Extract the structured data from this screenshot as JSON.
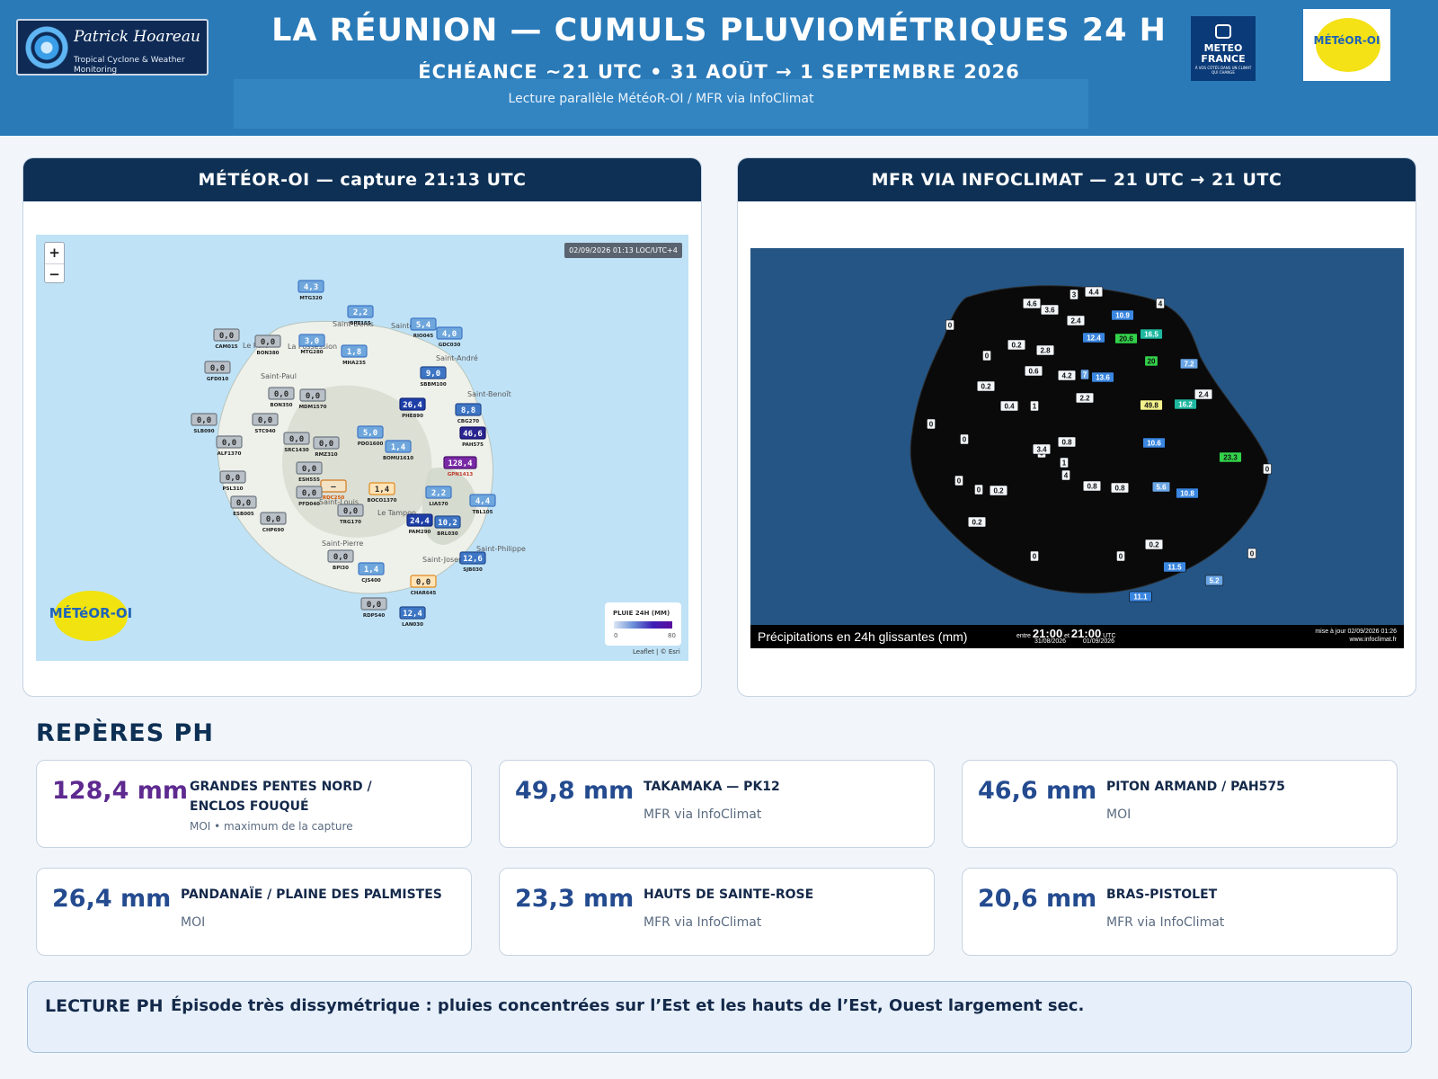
{
  "header": {
    "brand_name": "Patrick Hoareau",
    "brand_tagline": "Tropical Cyclone & Weather Monitoring",
    "title": "LA RÉUNION — CUMULS PLUVIOMÉTRIQUES 24 H",
    "subtitle": "ÉCHÉANCE ~21 UTC • 31 AOÛT → 1 SEPTEMBRE 2026",
    "sources_line": "Lecture parallèle MétéoR-OI / MFR via InfoClimat",
    "mf_logo_text": "METEO FRANCE",
    "mf_logo_tagline": "À VOS CÔTÉS DANS UN CLIMAT QUI CHANGE",
    "moi_logo_text": "MÉTéOR-OI"
  },
  "colors": {
    "header_bg": "#2a7ab8",
    "panel_head": "#0d3054",
    "accent": "#244b8f",
    "max_accent": "#5e2a90"
  },
  "panel_moi": {
    "title": "MÉTÉOR-OI — capture 21:13 UTC",
    "zoom_in": "+",
    "zoom_out": "−",
    "timestamp": "02/09/2026 01:13 LOC/UTC+4",
    "legend_title": "PLUIE 24H (MM)",
    "legend_min": "0",
    "legend_max": "80",
    "attribution": "Leaflet | © Esri",
    "logo_text": "MÉTéOR-OI",
    "places": [
      "Saint-Denis",
      "Sainte-Marie",
      "Saint-André",
      "Saint-Benoît",
      "Le Port",
      "La Possession",
      "Saint-Paul",
      "Saint-Louis",
      "Le Tampon",
      "Saint-Pierre",
      "Saint-Joseph",
      "Saint-Philippe"
    ],
    "stations": [
      {
        "code": "MTG320",
        "value": "4,3",
        "level": 1
      },
      {
        "code": "BRT155",
        "value": "2,2",
        "level": 1
      },
      {
        "code": "MTG280",
        "value": "3,0",
        "level": 1
      },
      {
        "code": "MHA235",
        "value": "1,8",
        "level": 1
      },
      {
        "code": "RIO045",
        "value": "5,4",
        "level": 1
      },
      {
        "code": "GDC030",
        "value": "4,0",
        "level": 1
      },
      {
        "code": "CAM015",
        "value": "0,0",
        "level": 0
      },
      {
        "code": "BON380",
        "value": "0,0",
        "level": 0
      },
      {
        "code": "GFD010",
        "value": "0,0",
        "level": 0
      },
      {
        "code": "BON350",
        "value": "0,0",
        "level": 0
      },
      {
        "code": "SBBM100",
        "value": "9,0",
        "level": 2
      },
      {
        "code": "MDM1570",
        "value": "0,0",
        "level": 0
      },
      {
        "code": "PHE890",
        "value": "26,4",
        "level": 3
      },
      {
        "code": "CBG270",
        "value": "8,8",
        "level": 2
      },
      {
        "code": "SLB090",
        "value": "0,0",
        "level": 0
      },
      {
        "code": "STC940",
        "value": "0,0",
        "level": 0
      },
      {
        "code": "PDO1600",
        "value": "5,0",
        "level": 1
      },
      {
        "code": "PAH575",
        "value": "46,6",
        "level": 4
      },
      {
        "code": "ALF1370",
        "value": "0,0",
        "level": 0
      },
      {
        "code": "SRC1430",
        "value": "0,0",
        "level": 0
      },
      {
        "code": "RMZ310",
        "value": "0,0",
        "level": 0
      },
      {
        "code": "BOMU1610",
        "value": "1,4",
        "level": 1
      },
      {
        "code": "GPN1413",
        "value": "128,4",
        "level": 5
      },
      {
        "code": "ESH555",
        "value": "0,0",
        "level": 0
      },
      {
        "code": "RDC250",
        "value": "—",
        "level": 6
      },
      {
        "code": "BOCO1370",
        "value": "1,4",
        "level": 7
      },
      {
        "code": "PSL310",
        "value": "0,0",
        "level": 0
      },
      {
        "code": "PFD040",
        "value": "0,0",
        "level": 0
      },
      {
        "code": "LIA570",
        "value": "2,2",
        "level": 1
      },
      {
        "code": "TBL105",
        "value": "4,4",
        "level": 1
      },
      {
        "code": "ESB005",
        "value": "0,0",
        "level": 0
      },
      {
        "code": "CHP690",
        "value": "0,0",
        "level": 0
      },
      {
        "code": "TRG170",
        "value": "0,0",
        "level": 0
      },
      {
        "code": "PAM290",
        "value": "24,4",
        "level": 3
      },
      {
        "code": "BRL030",
        "value": "10,2",
        "level": 2
      },
      {
        "code": "BPI30",
        "value": "0,0",
        "level": 0
      },
      {
        "code": "CJS400",
        "value": "1,4",
        "level": 1
      },
      {
        "code": "SJB030",
        "value": "12,6",
        "level": 2
      },
      {
        "code": "CHAR645",
        "value": "0,0",
        "level": 7
      },
      {
        "code": "RDP540",
        "value": "0,0",
        "level": 0
      },
      {
        "code": "LAN030",
        "value": "12,4",
        "level": 2
      }
    ]
  },
  "panel_mfr": {
    "title": "MFR VIA INFOCLIMAT — 21 UTC → 21 UTC",
    "caption": "Précipitations en 24h glissantes (mm)",
    "between": "entre",
    "and": "et",
    "start_time": "21:00",
    "end_time": "21:00",
    "tz": "UTC",
    "start_date": "31/08/2026",
    "end_date": "01/09/2026",
    "update": "mise à jour 02/09/2026 01:26",
    "site": "www.infoclimat.fr",
    "values": [
      "4.6",
      "3.6",
      "3",
      "4.4",
      "4",
      "0",
      "2.4",
      "10.9",
      "16.5",
      "12.4",
      "20.6",
      "0.2",
      "2.8",
      "0",
      "20",
      "7.2",
      "0.6",
      "4.2",
      "7",
      "13.6",
      "0.2",
      "2.2",
      "49.8",
      "16.2",
      "2.4",
      "0.4",
      "1",
      "0",
      "0",
      "0.8",
      "0",
      "10.6",
      "1",
      "23.3",
      "0",
      "3.4",
      "4",
      "0",
      "0.2",
      "0",
      "0.8",
      "0.8",
      "5.6",
      "10.8",
      "0.2",
      "0.2",
      "0",
      "0",
      "0",
      "11.5",
      "5.2",
      "11.1"
    ]
  },
  "reperes": {
    "title": "REPÈRES PH",
    "cards": [
      {
        "value": "128,4 mm",
        "name_l1": "GRANDES PENTES NORD /",
        "name_l2": "ENCLOS FOUQUÉ",
        "source": "MOI • maximum de la capture"
      },
      {
        "value": "49,8 mm",
        "name_l1": "TAKAMAKA — PK12",
        "name_l2": "",
        "source": "MFR via InfoClimat"
      },
      {
        "value": "46,6 mm",
        "name_l1": "PITON ARMAND / PAH575",
        "name_l2": "",
        "source": "MOI"
      },
      {
        "value": "26,4 mm",
        "name_l1": "PANDANAÏE / PLAINE DES PALMISTES",
        "name_l2": "",
        "source": "MOI"
      },
      {
        "value": "23,3 mm",
        "name_l1": "HAUTS DE SAINTE-ROSE",
        "name_l2": "",
        "source": "MFR via InfoClimat"
      },
      {
        "value": "20,6 mm",
        "name_l1": "BRAS-PISTOLET",
        "name_l2": "",
        "source": "MFR via InfoClimat"
      }
    ]
  },
  "lecture": {
    "label": "LECTURE PH",
    "text": "Épisode très dissymétrique : pluies concentrées sur l’Est et les hauts de l’Est, Ouest largement sec."
  }
}
